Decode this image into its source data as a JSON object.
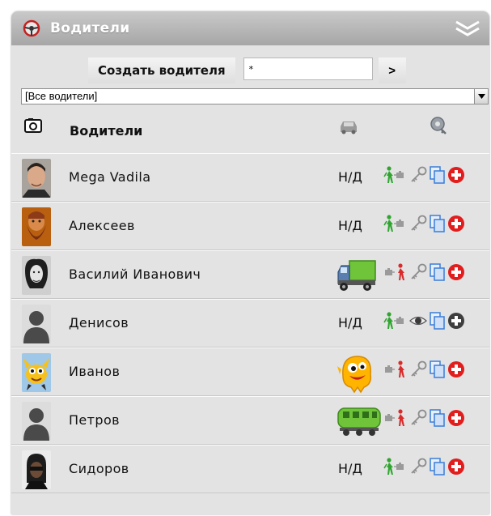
{
  "panel": {
    "title": "Водители",
    "accent": "#a9a9a9"
  },
  "toolbar": {
    "create_label": "Создать водителя",
    "search_value": "*",
    "go_label": ">"
  },
  "filter": {
    "selected": "[Все водители]"
  },
  "table": {
    "col_name": "Водители",
    "rows": [
      {
        "name": "Mega Vadila",
        "vehicle": "Н/Д",
        "vehicle_icon": "",
        "person_icon": "green-person-icon",
        "view_icon": "key-icon",
        "delete_color": "red"
      },
      {
        "name": "Алексеев",
        "vehicle": "Н/Д",
        "vehicle_icon": "",
        "person_icon": "green-person-icon",
        "view_icon": "key-icon",
        "delete_color": "red"
      },
      {
        "name": "Василий Иванович",
        "vehicle": "",
        "vehicle_icon": "truck-icon",
        "person_icon": "red-person-icon",
        "view_icon": "key-icon",
        "delete_color": "red"
      },
      {
        "name": "Денисов",
        "vehicle": "Н/Д",
        "vehicle_icon": "",
        "person_icon": "green-person-icon",
        "view_icon": "eye-icon",
        "delete_color": "gray"
      },
      {
        "name": "Иванов",
        "vehicle": "",
        "vehicle_icon": "monster-icon",
        "person_icon": "red-person-icon",
        "view_icon": "key-icon",
        "delete_color": "red"
      },
      {
        "name": "Петров",
        "vehicle": "",
        "vehicle_icon": "train-icon",
        "person_icon": "red-person-icon",
        "view_icon": "key-icon",
        "delete_color": "red"
      },
      {
        "name": "Сидоров",
        "vehicle": "Н/Д",
        "vehicle_icon": "",
        "person_icon": "green-person-icon",
        "view_icon": "key-icon",
        "delete_color": "red"
      }
    ]
  }
}
